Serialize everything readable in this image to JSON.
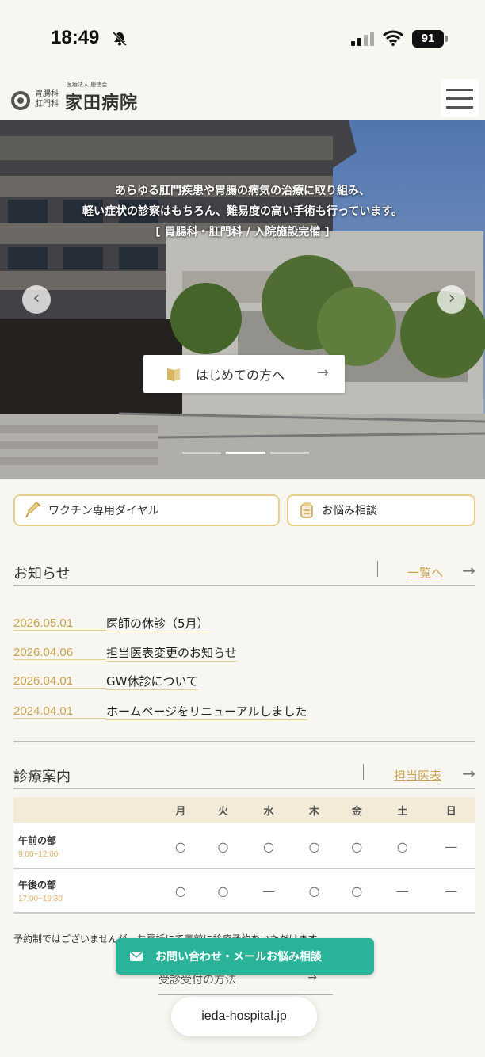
{
  "status_bar": {
    "time": "18:49",
    "battery": "91"
  },
  "header": {
    "logo_dept_1": "胃腸科",
    "logo_dept_2": "肛門科",
    "logo_corp": "医療法人 慶徳会",
    "logo_name": "家田病院"
  },
  "hero": {
    "line1": "あらゆる肛門疾患や胃腸の病気の治療に取り組み、",
    "line2": "軽い症状の診察はもちろん、難易度の高い手術も行っています。",
    "line3": "[ 胃腸科・肛門科 / 入院施設完備 ]",
    "first_visit_label": "はじめての方へ",
    "first_visit_arrow": "→"
  },
  "quick_links": {
    "vaccine": "ワクチン専用ダイヤル",
    "consult": "お悩み相談"
  },
  "news": {
    "title": "お知らせ",
    "list_link": "一覧へ",
    "items": [
      {
        "date": "2026.05.01",
        "title": "医師の休診（5月）"
      },
      {
        "date": "2026.04.06",
        "title": "担当医表変更のお知らせ"
      },
      {
        "date": "2026.04.01",
        "title": "GW休診について"
      },
      {
        "date": "2024.04.01",
        "title": "ホームページをリニューアルしました"
      }
    ]
  },
  "schedule": {
    "title": "診療案内",
    "doctors_link": "担当医表",
    "days": [
      "月",
      "火",
      "水",
      "木",
      "金",
      "土",
      "日"
    ],
    "rows": [
      {
        "name": "午前の部",
        "hours": "9:00~12:00",
        "marks": [
          "○",
          "○",
          "○",
          "○",
          "○",
          "○",
          "—"
        ]
      },
      {
        "name": "午後の部",
        "hours": "17:00~19:30",
        "marks": [
          "○",
          "○",
          "—",
          "○",
          "○",
          "—",
          "—"
        ]
      }
    ],
    "note": "予約制ではございませんが、お電話にて事前に診療予約をいただけます。",
    "sub_link": "受診受付の方法"
  },
  "floating_contact": {
    "label": "お問い合わせ・メールお悩み相談"
  },
  "browser": {
    "url": "ieda-hospital.jp"
  },
  "colors": {
    "accent_gold": "#c9a24e",
    "border_gold": "#e6cf8f",
    "contact_green": "#2bb39a",
    "background": "#f8f6f1"
  }
}
